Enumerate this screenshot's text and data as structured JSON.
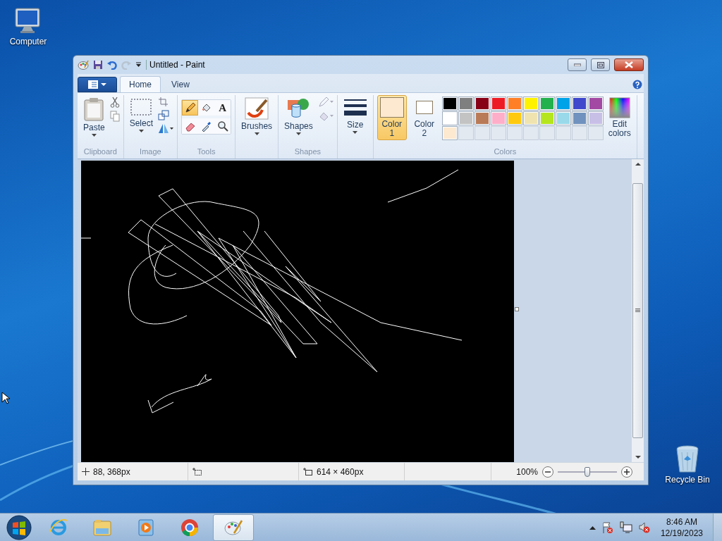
{
  "desktop_icons": [
    {
      "label": "Computer",
      "kind": "computer"
    },
    {
      "label": "Recycle Bin",
      "kind": "bin"
    }
  ],
  "window": {
    "title": "Untitled - Paint"
  },
  "tabs": [
    {
      "label": "Home",
      "selected": true
    },
    {
      "label": "View",
      "selected": false
    }
  ],
  "ribbon": {
    "paste": "Paste",
    "clipboard": "Clipboard",
    "select": "Select",
    "image": "Image",
    "tools_label": "Tools",
    "brushes": "Brushes",
    "shapes": "Shapes",
    "shapes_label": "Shapes",
    "size": "Size",
    "colors_label": "Colors",
    "edit_colors": "Edit\ncolors"
  },
  "tools": [
    {
      "kind": "pencil",
      "selected": true
    },
    {
      "kind": "fill",
      "selected": false
    },
    {
      "kind": "text",
      "label": "A",
      "selected": false
    },
    {
      "kind": "eraser",
      "selected": false
    },
    {
      "kind": "picker",
      "selected": false
    },
    {
      "kind": "magnifier",
      "selected": false
    }
  ],
  "color_slots": [
    {
      "label": "Color\n1",
      "color": "#fde9d0",
      "selected": true
    },
    {
      "label": "Color\n2",
      "color": "#ffffff",
      "selected": false
    }
  ],
  "palette": [
    {
      "color": "#000000"
    },
    {
      "color": "#7f7f7f"
    },
    {
      "color": "#880015"
    },
    {
      "color": "#ed1c24"
    },
    {
      "color": "#ff7f27"
    },
    {
      "color": "#fff200"
    },
    {
      "color": "#22b14c"
    },
    {
      "color": "#00a2e8"
    },
    {
      "color": "#3f48cc"
    },
    {
      "color": "#a349a4"
    },
    {
      "color": "#ffffff"
    },
    {
      "color": "#c3c3c3"
    },
    {
      "color": "#b97a57"
    },
    {
      "color": "#ffaec9"
    },
    {
      "color": "#ffc90e"
    },
    {
      "color": "#efe4b0"
    },
    {
      "color": "#b5e61d"
    },
    {
      "color": "#99d9ea"
    },
    {
      "color": "#7092be"
    },
    {
      "color": "#c8bfe7"
    },
    {
      "color": "#fde9d0"
    }
  ],
  "status_bar": {
    "position": "88, 368px",
    "canvas_size": "614 × 460px",
    "zoom": {
      "reading": "100%",
      "level": 0.5
    }
  },
  "taskbar": {
    "apps": [
      {
        "kind": "ie",
        "selected": false
      },
      {
        "kind": "explorer",
        "selected": false
      },
      {
        "kind": "media",
        "selected": false
      },
      {
        "kind": "chrome",
        "selected": false
      },
      {
        "kind": "paint",
        "selected": true
      }
    ],
    "time": "8:46 AM",
    "date": "12/19/2023"
  }
}
